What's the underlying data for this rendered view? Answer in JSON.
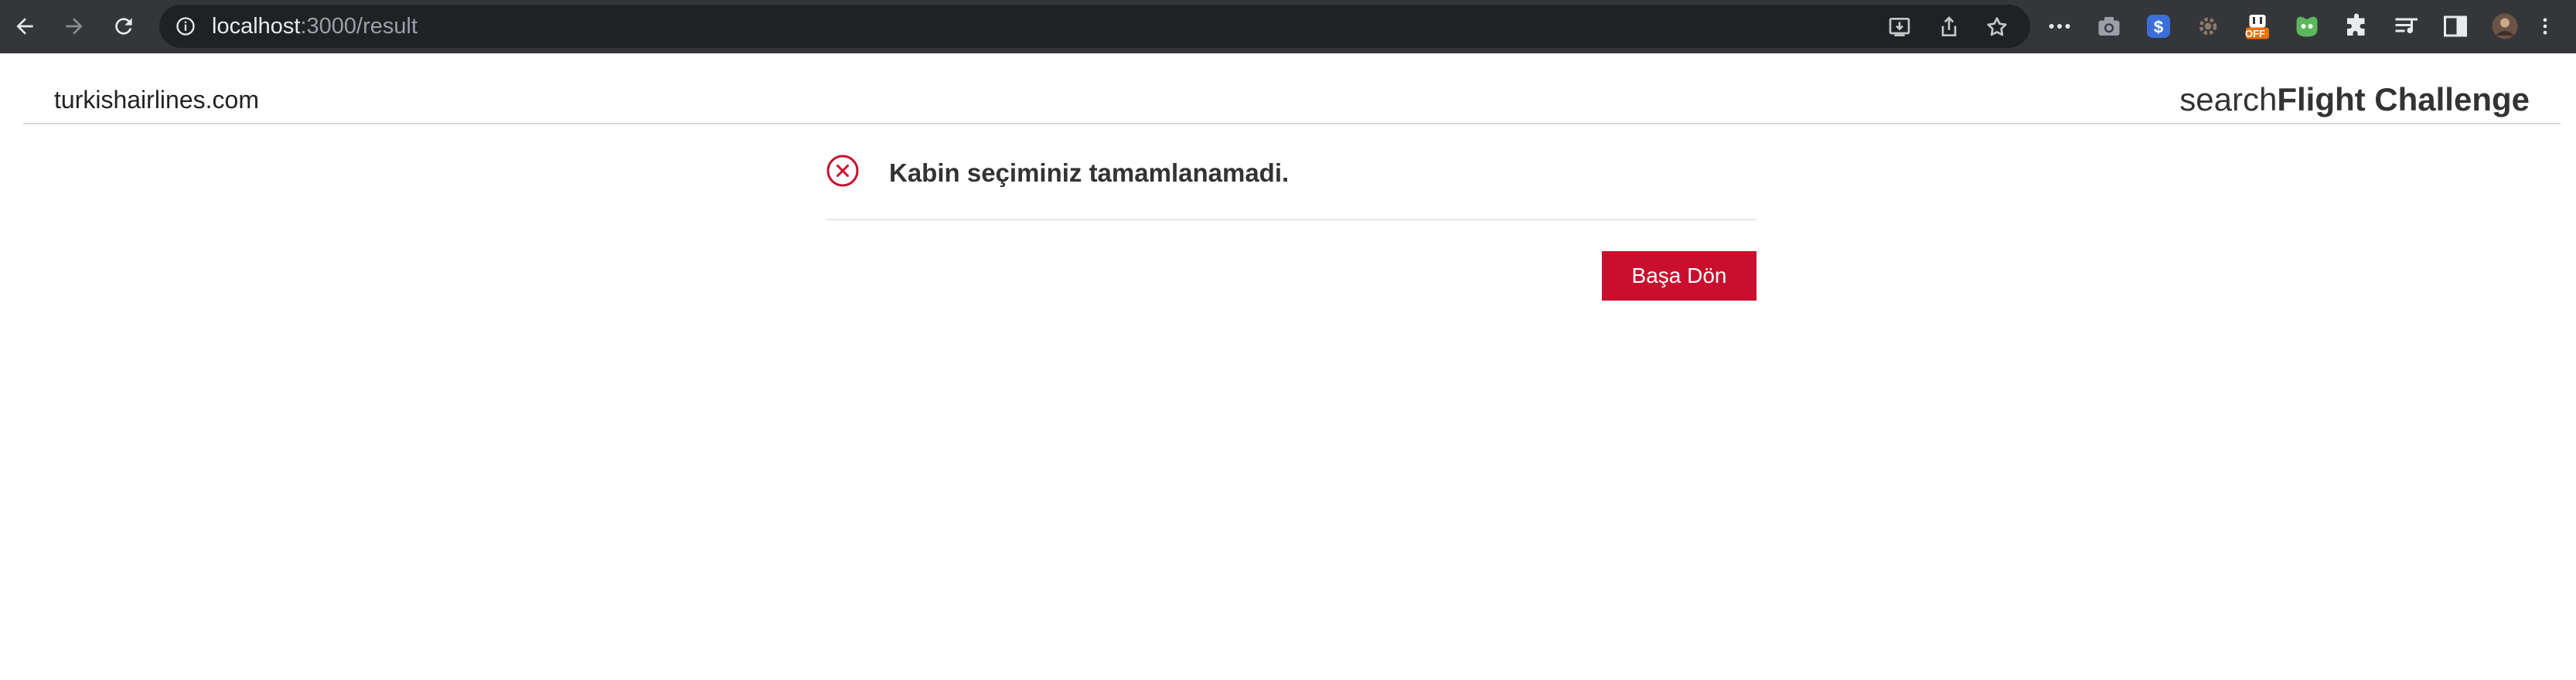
{
  "browser": {
    "url_host": "localhost",
    "url_path": ":3000/result",
    "icons": {
      "back": "arrow-left-icon",
      "forward": "arrow-right-icon",
      "reload": "reload-icon",
      "info": "info-icon",
      "install": "install-icon",
      "share": "share-icon",
      "bookmark": "star-icon"
    },
    "extensions": [
      "more-horizontal-icon",
      "camera-icon",
      "dollar-extension-icon",
      "settings-extension-icon",
      "off-extension-icon",
      "green-extension-icon",
      "puzzle-icon",
      "reading-list-icon",
      "side-panel-icon",
      "profile-avatar",
      "kebab-menu-icon"
    ],
    "off_badge": "OFF"
  },
  "header": {
    "domain": "turkishairlines.com",
    "brand_prefix": "search",
    "brand_suffix": "Flight Challenge"
  },
  "result": {
    "message": "Kabin seçiminiz tamamlanamadi.",
    "button_label": "Başa Dön",
    "status_icon": "error-x-icon"
  },
  "colors": {
    "accent_red": "#c8102e",
    "chrome_bg": "#35363a"
  }
}
